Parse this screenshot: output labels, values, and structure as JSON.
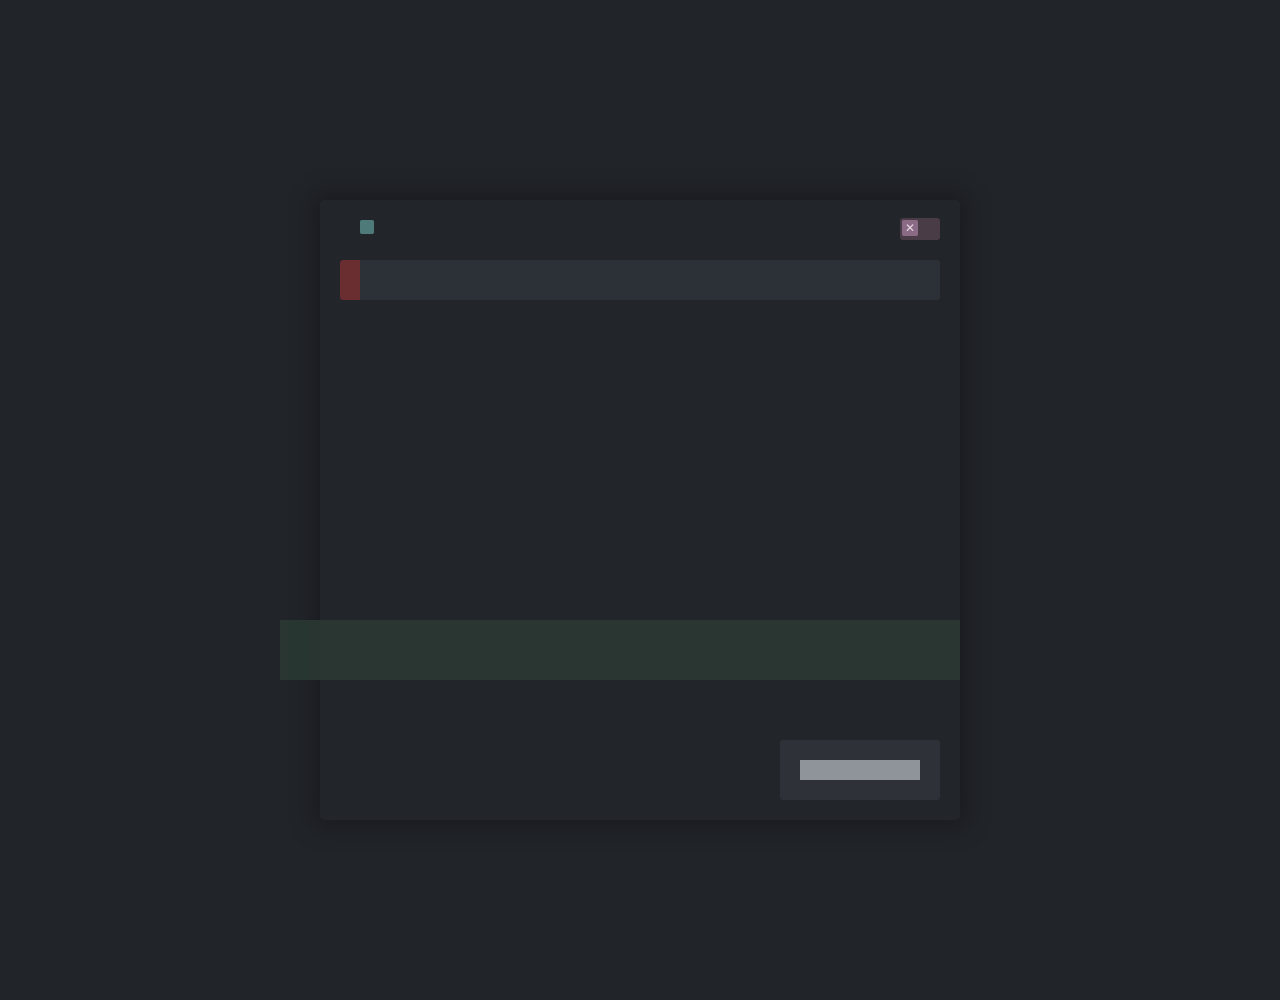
{
  "colors": {
    "background": "#212429",
    "dialog": "#22252a",
    "accent_teal": "#4e7a79",
    "accent_red": "#6a2d30",
    "close_pink": "#8b6a86",
    "highlight_green": "#2f4a40"
  },
  "dialog": {
    "title": "",
    "subtitle": "",
    "field_text": "",
    "section_label": "",
    "paragraphs": [
      "",
      "",
      "",
      ""
    ],
    "close_icon": "close-icon",
    "ok_label": ""
  }
}
